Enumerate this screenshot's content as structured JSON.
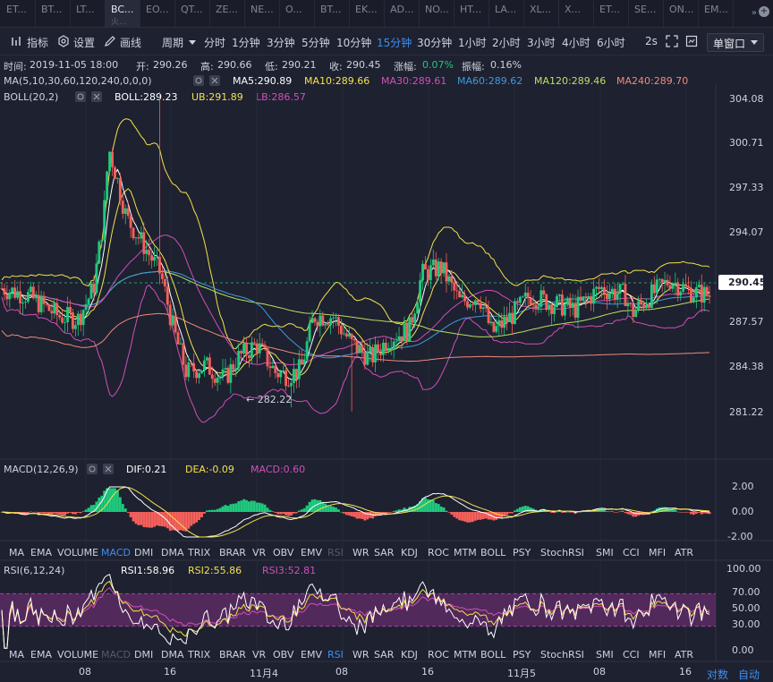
{
  "tabs": [
    {
      "label": "ET...",
      "sub": "",
      "active": false
    },
    {
      "label": "BT...",
      "sub": "",
      "active": false
    },
    {
      "label": "LT...",
      "sub": "",
      "active": false
    },
    {
      "label": "BC...",
      "sub": "火...",
      "active": true
    },
    {
      "label": "EO...",
      "sub": "",
      "active": false
    },
    {
      "label": "QT...",
      "sub": "",
      "active": false
    },
    {
      "label": "ZE...",
      "sub": "",
      "active": false
    },
    {
      "label": "NE...",
      "sub": "",
      "active": false
    },
    {
      "label": "O...",
      "sub": "",
      "active": false
    },
    {
      "label": "BT...",
      "sub": "",
      "active": false
    },
    {
      "label": "EK...",
      "sub": "",
      "active": false
    },
    {
      "label": "AD...",
      "sub": "",
      "active": false
    },
    {
      "label": "NO...",
      "sub": "",
      "active": false
    },
    {
      "label": "HT...",
      "sub": "",
      "active": false
    },
    {
      "label": "LA...",
      "sub": "",
      "active": false
    },
    {
      "label": "XL...",
      "sub": "",
      "active": false
    },
    {
      "label": "X...",
      "sub": "",
      "active": false
    },
    {
      "label": "ET...",
      "sub": "",
      "active": false
    },
    {
      "label": "SE...",
      "sub": "",
      "active": false
    },
    {
      "label": "ON...",
      "sub": "",
      "active": false
    },
    {
      "label": "EM...",
      "sub": "",
      "active": false
    }
  ],
  "tab_more": "»",
  "tab_plus": "+",
  "toolbar": {
    "indicators": "指标",
    "settings": "设置",
    "draw": "画线",
    "period": "周期",
    "periods": [
      "分时",
      "1分钟",
      "3分钟",
      "5分钟",
      "10分钟",
      "15分钟",
      "30分钟",
      "1小时",
      "2小时",
      "3小时",
      "4小时",
      "6小时"
    ],
    "active_period": "15分钟",
    "refresh": "2s",
    "window": "单窗口"
  },
  "info": {
    "time_label": "时间:",
    "time": "2019-11-05 18:00",
    "open_label": "开:",
    "open": "290.26",
    "high_label": "高:",
    "high": "290.66",
    "low_label": "低:",
    "low": "290.21",
    "close_label": "收:",
    "close": "290.45",
    "change_label": "涨幅:",
    "change": "0.07%",
    "amp_label": "振幅:",
    "amp": "0.16%"
  },
  "ma": {
    "title": "MA(5,10,30,60,120,240,0,0,0)",
    "ma5": "MA5:290.89",
    "ma10": "MA10:289.66",
    "ma30": "MA30:289.61",
    "ma60": "MA60:289.62",
    "ma120": "MA120:289.46",
    "ma240": "MA240:289.70"
  },
  "boll": {
    "title": "BOLL(20,2)",
    "boll": "BOLL:289.23",
    "ub": "UB:291.89",
    "lb": "LB:286.57"
  },
  "price_axis": [
    "304.08",
    "300.71",
    "297.33",
    "294.07",
    "290.45",
    "287.57",
    "284.38",
    "281.22"
  ],
  "last_price": "290.45",
  "low_marker": "← 282.22",
  "macd": {
    "title": "MACD(12,26,9)",
    "dif": "DIF:0.21",
    "dea": "DEA:-0.09",
    "macd": "MACD:0.60",
    "axis": [
      "2.00",
      "0.00",
      "-2.00"
    ]
  },
  "rsi": {
    "title": "RSI(6,12,24)",
    "rsi1": "RSI1:58.96",
    "rsi2": "RSI2:55.86",
    "rsi3": "RSI3:52.81",
    "axis": [
      "100.00",
      "70.00",
      "50.00",
      "30.00",
      "0.00"
    ]
  },
  "indicator_tabs": [
    "MA",
    "EMA",
    "VOLUME",
    "MACD",
    "DMI",
    "DMA",
    "TRIX",
    "BRAR",
    "VR",
    "OBV",
    "EMV",
    "RSI",
    "WR",
    "SAR",
    "KDJ",
    "ROC",
    "MTM",
    "BOLL",
    "PSY",
    "StochRSI",
    "SMI",
    "CCI",
    "MFI",
    "ATR"
  ],
  "time_axis": [
    "08",
    "16",
    "11月4",
    "08",
    "16",
    "11月5",
    "08",
    "16"
  ],
  "scale_log": "对数",
  "scale_auto": "自动",
  "colors": {
    "bg": "#1e2130",
    "up": "#1fc97e",
    "down": "#f5605b",
    "accent": "#3d8ef0",
    "ma5": "#ffffff",
    "ma10": "#f2e24a",
    "ma30": "#d050b8",
    "ma60": "#3d9ae0",
    "ma120": "#b8e060",
    "ma240": "#f08a7a"
  }
}
